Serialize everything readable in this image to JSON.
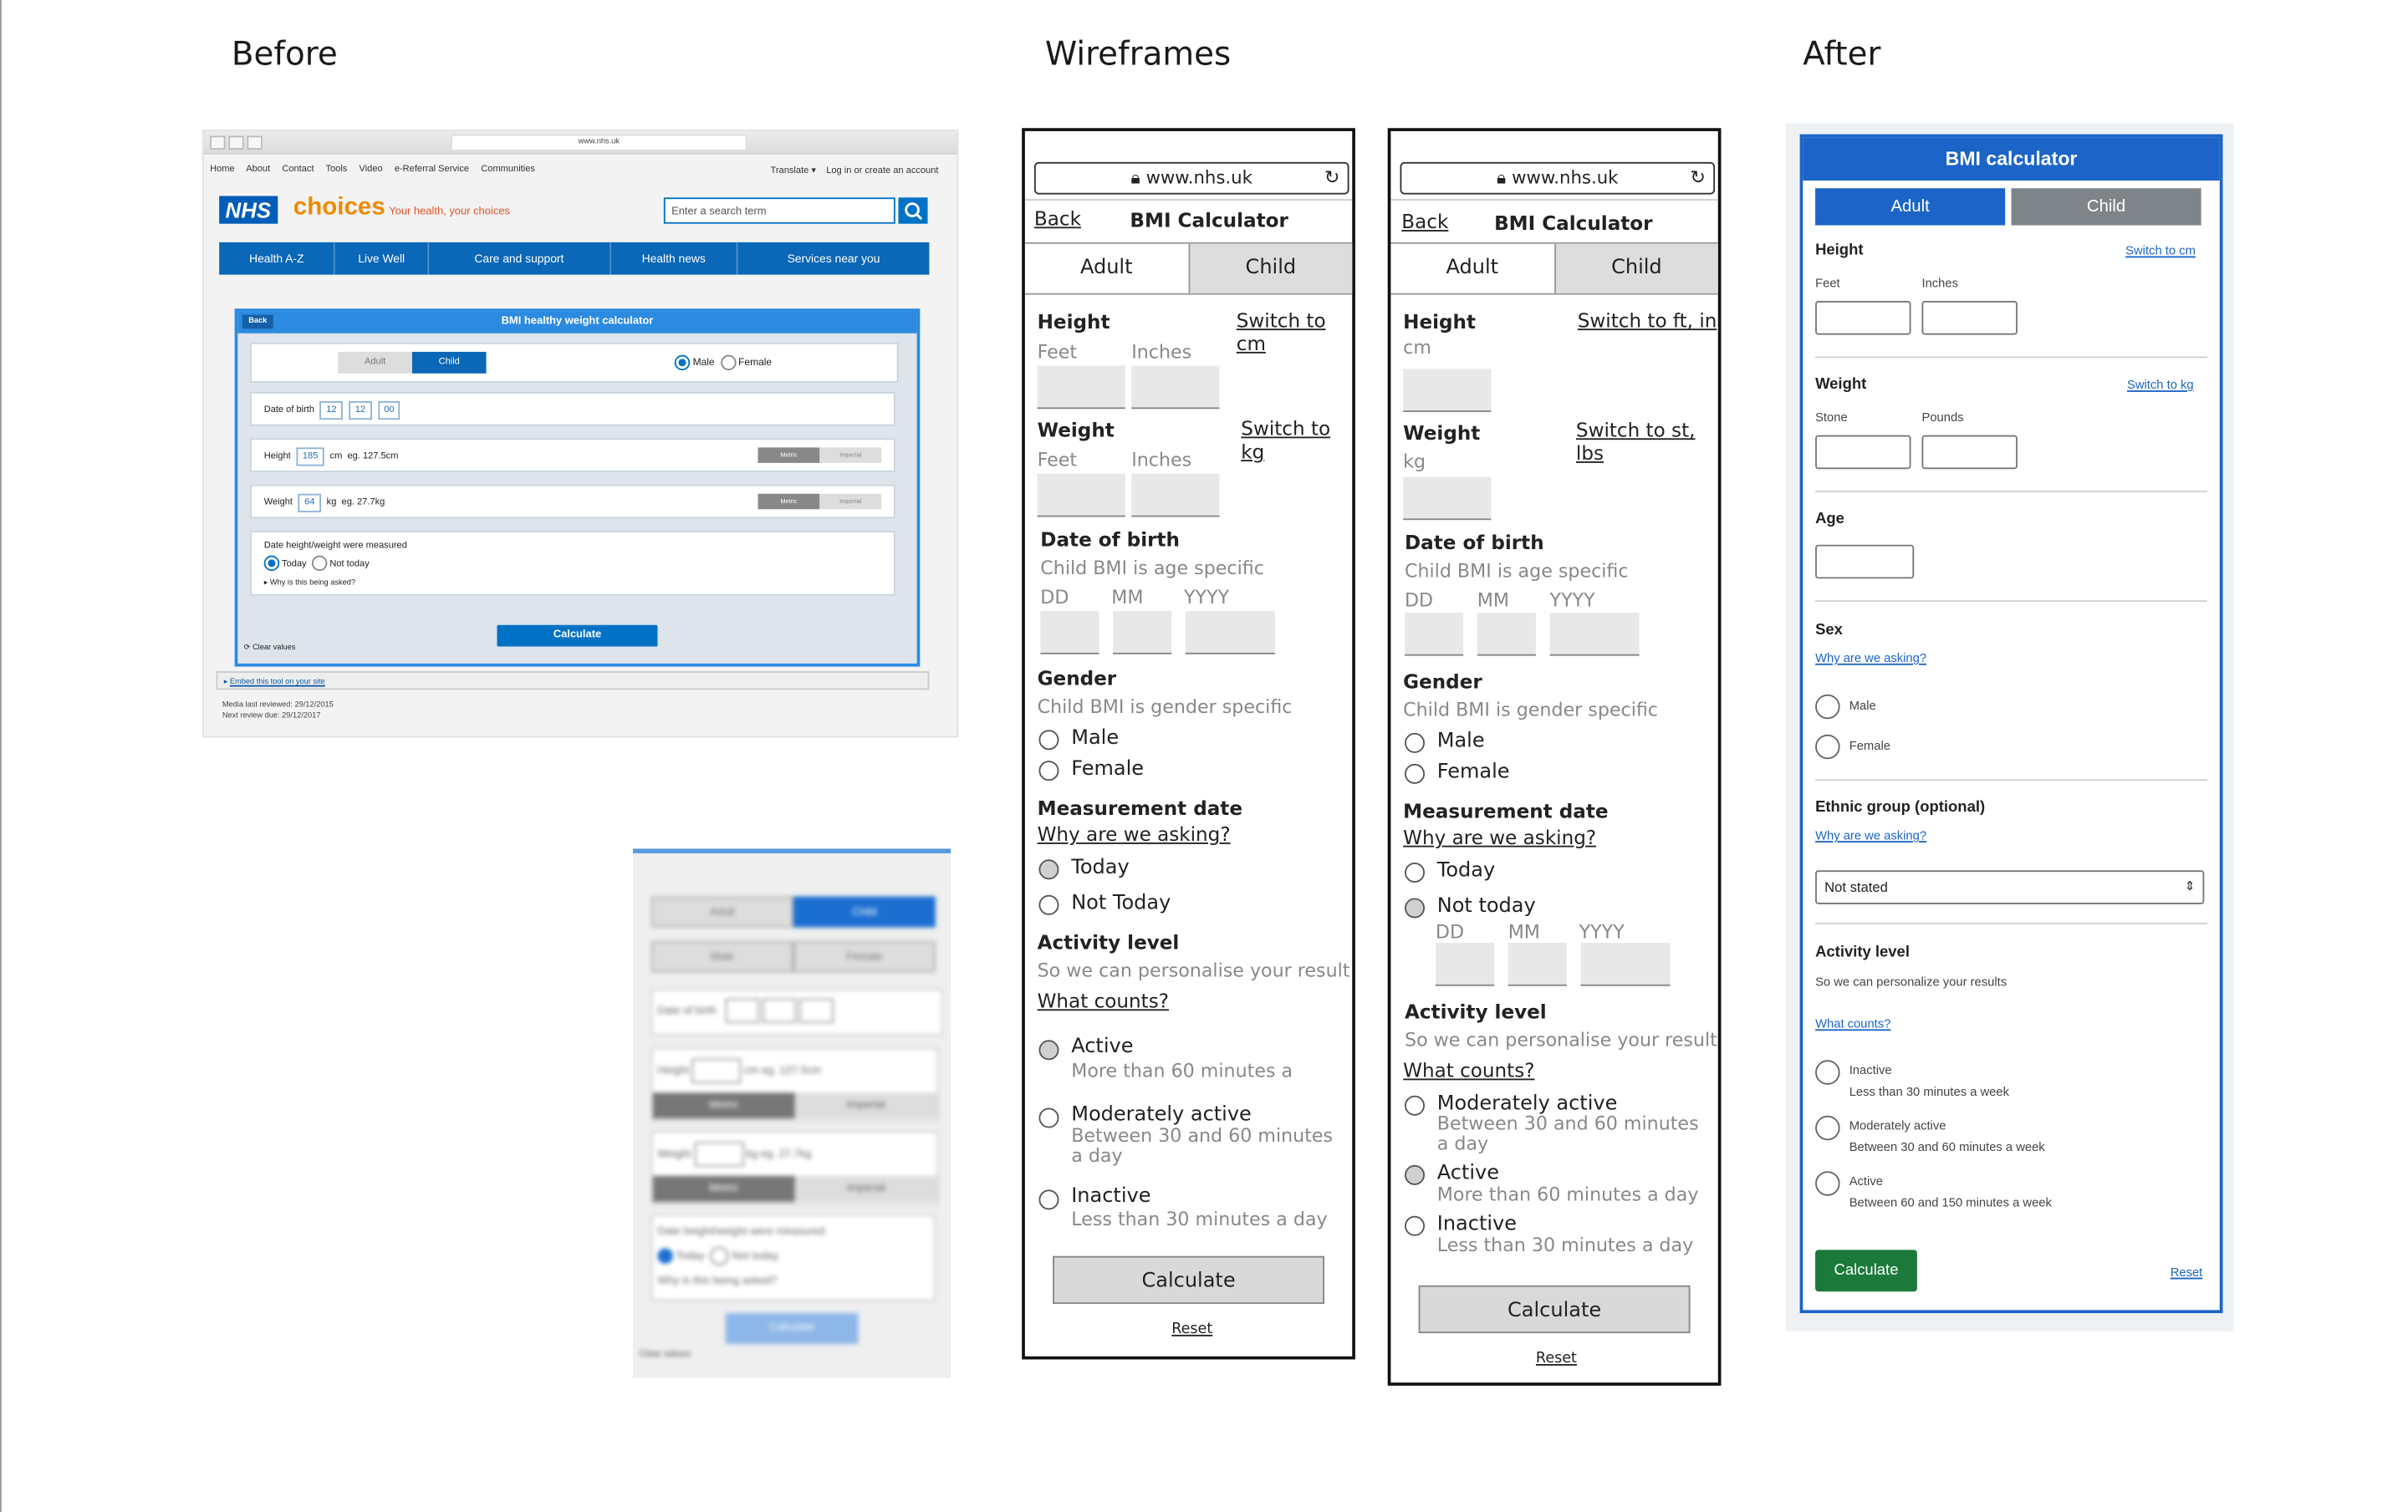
{
  "headings": {
    "before": "Before",
    "wireframes": "Wireframes",
    "after": "After"
  },
  "before": {
    "browser_url": "www.nhs.uk",
    "top_links": [
      "Home",
      "About",
      "Contact",
      "Tools",
      "Video",
      "e-Referral Service",
      "Communities"
    ],
    "translate": "Translate ▾",
    "login": "Log in or create an account",
    "logo": "NHS",
    "brand": "choices",
    "tagline": "Your health, your choices",
    "search_placeholder": "Enter a search term",
    "nav": [
      "Health A-Z",
      "Live Well",
      "Care and support",
      "Health news",
      "Services near you"
    ],
    "calc": {
      "back": "Back",
      "title": "BMI healthy weight calculator",
      "adult": "Adult",
      "child": "Child",
      "male": "Male",
      "female": "Female",
      "dob_label": "Date of birth",
      "dob": [
        "12",
        "12",
        "00"
      ],
      "height_label": "Height",
      "height_value": "185",
      "height_unit": "cm",
      "height_eg": "eg. 127.5cm",
      "weight_label": "Weight",
      "weight_value": "64",
      "weight_unit": "kg",
      "weight_eg": "eg. 27.7kg",
      "metric": "Metric",
      "imperial": "Imperial",
      "measured_label": "Date height/weight were measured",
      "today": "Today",
      "not_today": "Not today",
      "why": "Why is this being asked?",
      "calculate": "Calculate",
      "clear": "Clear values"
    },
    "embed": "Embed this tool on your site",
    "reviewed": "Media last reviewed: 29/12/2015",
    "next_review": "Next review due: 29/12/2017",
    "mobile": {
      "adult": "Adult",
      "child": "Child",
      "male": "Male",
      "female": "Female",
      "dob": "Date of birth",
      "height": "Height",
      "height_unit": "cm",
      "height_eg": "eg. 127.5cm",
      "weight": "Weight",
      "weight_unit": "kg",
      "weight_eg": "eg. 27.7kg",
      "metric": "Metric",
      "imperial": "Imperial",
      "measured": "Date height/weight were measured",
      "today": "Today",
      "not_today": "Not today",
      "why": "Why is this being asked?",
      "calculate": "Calculate",
      "clear": "Clear values"
    }
  },
  "wireframe1": {
    "url": "www.nhs.uk",
    "back": "Back",
    "title": "BMI Calculator",
    "tab_adult": "Adult",
    "tab_child": "Child",
    "height": "Height",
    "height_switch": "Switch to cm",
    "feet": "Feet",
    "inches": "Inches",
    "weight": "Weight",
    "weight_switch": "Switch to kg",
    "w_feet": "Feet",
    "w_inches": "Inches",
    "dob": "Date of birth",
    "dob_hint": "Child BMI is age specific",
    "dd": "DD",
    "mm": "MM",
    "yyyy": "YYYY",
    "gender": "Gender",
    "gender_hint": "Child BMI is gender specific",
    "male": "Male",
    "female": "Female",
    "measurement": "Measurement date",
    "why": "Why are we asking?",
    "today": "Today",
    "not_today": "Not Today",
    "activity": "Activity level",
    "activity_hint": "So we can personalise your result",
    "what_counts": "What counts?",
    "active": "Active",
    "active_hint": "More than 60 minutes a",
    "moderate": "Moderately active",
    "moderate_hint": "Between 30 and 60 minutes a day",
    "inactive": "Inactive",
    "inactive_hint": "Less than 30 minutes a day",
    "calculate": "Calculate",
    "reset": "Reset"
  },
  "wireframe2": {
    "url": "www.nhs.uk",
    "back": "Back",
    "title": "BMI Calculator",
    "tab_adult": "Adult",
    "tab_child": "Child",
    "height": "Height",
    "height_switch": "Switch to ft, in",
    "cm": "cm",
    "weight": "Weight",
    "weight_switch": "Switch to st, lbs",
    "kg": "kg",
    "dob": "Date of birth",
    "dob_hint": "Child BMI is age specific",
    "dd": "DD",
    "mm": "MM",
    "yyyy": "YYYY",
    "gender": "Gender",
    "gender_hint": "Child BMI is gender specific",
    "male": "Male",
    "female": "Female",
    "measurement": "Measurement date",
    "why": "Why are we asking?",
    "today": "Today",
    "not_today": "Not today",
    "dd2": "DD",
    "mm2": "MM",
    "yyyy2": "YYYY",
    "activity": "Activity level",
    "activity_hint": "So we can personalise your result",
    "what_counts": "What counts?",
    "moderate": "Moderately active",
    "moderate_hint": "Between 30 and 60 minutes a day",
    "active": "Active",
    "active_hint": "More than 60 minutes a day",
    "inactive": "Inactive",
    "inactive_hint": "Less than 30 minutes a day",
    "calculate": "Calculate",
    "reset": "Reset"
  },
  "after": {
    "title": "BMI calculator",
    "tab_adult": "Adult",
    "tab_child": "Child",
    "height": "Height",
    "height_switch": "Switch to cm",
    "feet": "Feet",
    "inches": "Inches",
    "weight": "Weight",
    "weight_switch": "Switch to kg",
    "stone": "Stone",
    "pounds": "Pounds",
    "age": "Age",
    "sex": "Sex",
    "sex_why": "Why are we asking?",
    "male": "Male",
    "female": "Female",
    "ethnic": "Ethnic group (optional)",
    "ethnic_why": "Why are we asking?",
    "ethnic_value": "Not stated",
    "activity": "Activity level",
    "activity_hint": "So we can personalize your results",
    "what_counts": "What counts?",
    "inactive": "Inactive",
    "inactive_hint": "Less than 30 minutes a week",
    "moderate": "Moderately active",
    "moderate_hint": "Between 30 and 60 minutes a week",
    "active": "Active",
    "active_hint": "Between 60 and 150 minutes a week",
    "calculate": "Calculate",
    "reset": "Reset",
    "colors": {
      "primary": "#1c64c7",
      "calculate": "#1b7a3a",
      "tab_inactive": "#7f8489"
    }
  }
}
